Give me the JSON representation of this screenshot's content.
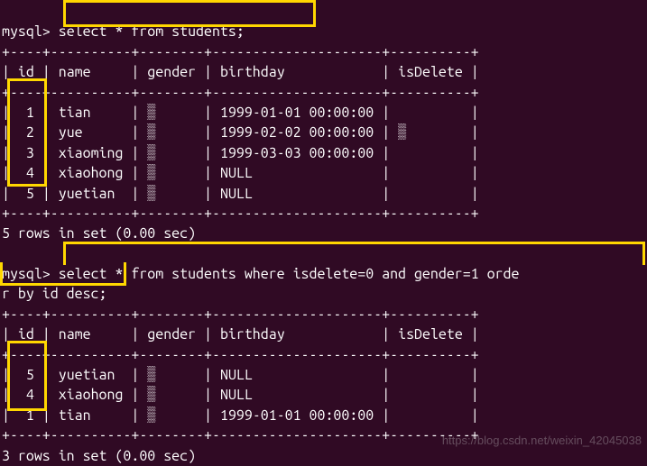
{
  "prompt": "mysql>",
  "query1": "select * from students;",
  "divider_top": "+----+----------+--------+---------------------+----------+",
  "header": {
    "id": "id",
    "name": "name",
    "gender": "gender",
    "birthday": "birthday",
    "isDelete": "isDelete"
  },
  "table1": {
    "rows": [
      {
        "id": "1",
        "name": "tian    ",
        "gender": "▒",
        "birthday": "1999-01-01 00:00:00",
        "isDelete": " "
      },
      {
        "id": "2",
        "name": "yue     ",
        "gender": "▒",
        "birthday": "1999-02-02 00:00:00",
        "isDelete": "▒"
      },
      {
        "id": "3",
        "name": "xiaoming",
        "gender": "▒",
        "birthday": "1999-03-03 00:00:00",
        "isDelete": " "
      },
      {
        "id": "4",
        "name": "xiaohong",
        "gender": "▒",
        "birthday": "NULL               ",
        "isDelete": " "
      },
      {
        "id": "5",
        "name": "yuetian ",
        "gender": "▒",
        "birthday": "NULL               ",
        "isDelete": " "
      }
    ],
    "footer": "5 rows in set (0.00 sec)"
  },
  "query2_line1": "select * from students where isdelete=0 and gender=1 orde",
  "query2_line2": "r by id desc;",
  "table2": {
    "rows": [
      {
        "id": "5",
        "name": "yuetian ",
        "gender": "▒",
        "birthday": "NULL               ",
        "isDelete": " "
      },
      {
        "id": "4",
        "name": "xiaohong",
        "gender": "▒",
        "birthday": "NULL               ",
        "isDelete": " "
      },
      {
        "id": "1",
        "name": "tian    ",
        "gender": "▒",
        "birthday": "1999-01-01 00:00:00",
        "isDelete": " "
      }
    ],
    "footer": "3 rows in set (0.00 sec)"
  },
  "watermark": "https://blog.csdn.net/weixin_42045038",
  "separator": "+----+----------+--------+---------------------+----------+"
}
